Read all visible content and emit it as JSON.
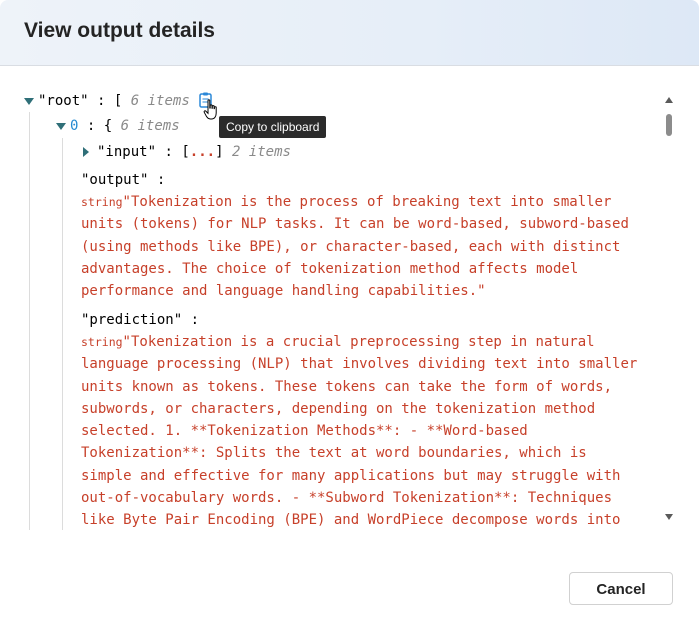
{
  "dialog": {
    "title": "View output details",
    "cancel_label": "Cancel"
  },
  "tree": {
    "root": {
      "key": "\"root\"",
      "colon": ":",
      "open_bracket": "[",
      "count": "6 items"
    },
    "item0": {
      "key": "0",
      "colon": ":",
      "open_brace": "{",
      "count": "6 items"
    },
    "input": {
      "key": "\"input\"",
      "colon": ":",
      "open_bracket": "[",
      "ellipsis": "...",
      "close_bracket": "]",
      "count": "2 items"
    },
    "output": {
      "key": "\"output\"",
      "colon": ":",
      "type": "string",
      "value_lines": [
        "\"Tokenization is the process of breaking text into smaller",
        "units (tokens) for NLP tasks. It can be word-based, subword-based",
        "(using methods like BPE), or character-based, each with distinct",
        "advantages. The choice of tokenization method affects model",
        "performance and language handling capabilities.\""
      ]
    },
    "prediction": {
      "key": "\"prediction\"",
      "colon": ":",
      "type": "string",
      "value_lines": [
        "\"Tokenization is a crucial preprocessing step in natural",
        "language processing (NLP) that involves dividing text into smaller",
        "units known as tokens. These tokens can take the form of words,",
        "subwords, or characters, depending on the tokenization method",
        "selected. 1. **Tokenization Methods**: - **Word-based",
        "Tokenization**: Splits the text at word boundaries, which is",
        "simple and effective for many applications but may struggle with",
        "out-of-vocabulary words. - **Subword Tokenization**: Techniques",
        "like Byte Pair Encoding (BPE) and WordPiece decompose words into"
      ]
    }
  },
  "tooltip": {
    "text": "Copy to clipboard"
  },
  "icons": {
    "clipboard": "clipboard-icon",
    "cursor": "hand-cursor-icon"
  },
  "colors": {
    "string_value": "#c7402a",
    "caret": "#2f6f78",
    "index": "#268bd2",
    "count": "#8a8a8a"
  }
}
